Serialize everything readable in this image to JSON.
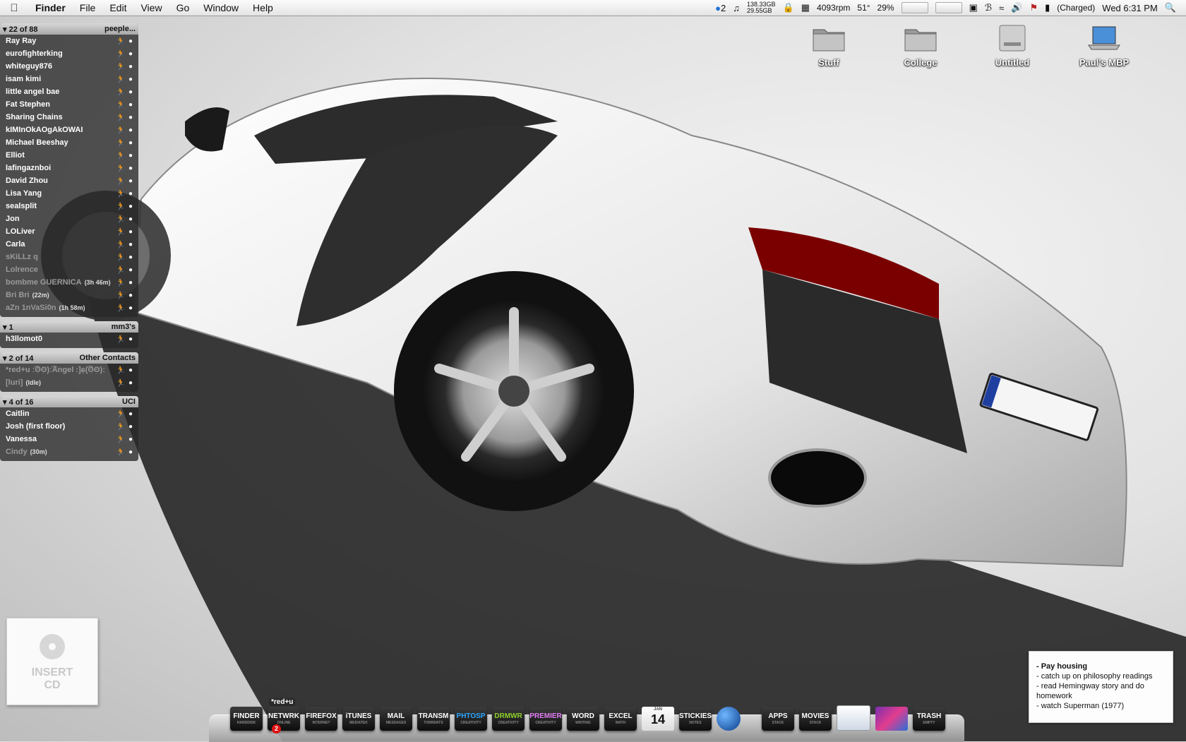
{
  "menubar": {
    "app": "Finder",
    "menus": [
      "File",
      "Edit",
      "View",
      "Go",
      "Window",
      "Help"
    ],
    "status": {
      "notify_count": "2",
      "disk_top": "138.33GB",
      "disk_bottom": "29.55GB",
      "fan": "4093rpm",
      "temp": "51°",
      "cpu": "29%",
      "battery": "(Charged)",
      "clock": "Wed 6:31 PM"
    }
  },
  "desktop_icons": [
    {
      "label": "Stuff"
    },
    {
      "label": "College"
    },
    {
      "label": "Untitled"
    },
    {
      "label": "Paul's MBP"
    }
  ],
  "buddy_list": {
    "groups": [
      {
        "count": "22 of 88",
        "name": "peeple...",
        "buddies": [
          {
            "name": "Ray Ray",
            "note": "",
            "idle": false
          },
          {
            "name": "eurofighterking",
            "note": "",
            "idle": false
          },
          {
            "name": "whiteguy876",
            "note": "",
            "idle": false
          },
          {
            "name": "isam kimi",
            "note": "",
            "idle": false
          },
          {
            "name": "little angel bae",
            "note": "",
            "idle": false
          },
          {
            "name": "Fat Stephen",
            "note": "",
            "idle": false
          },
          {
            "name": "Sharing Chains",
            "note": "",
            "idle": false
          },
          {
            "name": "kIMInOkAOgAkOWAI",
            "note": "",
            "idle": false
          },
          {
            "name": "Michael Beeshay",
            "note": "",
            "idle": false
          },
          {
            "name": "Elliot",
            "note": "",
            "idle": false
          },
          {
            "name": "lafingaznboi",
            "note": "",
            "idle": false
          },
          {
            "name": "David Zhou",
            "note": "",
            "idle": false
          },
          {
            "name": "Lisa Yang",
            "note": "",
            "idle": false
          },
          {
            "name": "sealsplit",
            "note": "",
            "idle": false
          },
          {
            "name": "Jon",
            "note": "",
            "idle": false
          },
          {
            "name": "LOLiver",
            "note": "",
            "idle": false
          },
          {
            "name": "Carla",
            "note": "",
            "idle": false
          },
          {
            "name": "sKiLLz q",
            "note": "",
            "idle": true
          },
          {
            "name": "Lolrence",
            "note": "",
            "idle": true
          },
          {
            "name": "bombme GUERNICA",
            "note": "(3h 46m)",
            "idle": true
          },
          {
            "name": "Bri Bri",
            "note": "(22m)",
            "idle": true
          },
          {
            "name": "aZn 1nVaSi0n",
            "note": "(1h 58m)",
            "idle": true
          }
        ]
      },
      {
        "count": "1",
        "name": "mm3's",
        "buddies": [
          {
            "name": "h3llomot0",
            "note": "",
            "idle": false
          }
        ]
      },
      {
        "count": "2 of 14",
        "name": "Other Contacts",
        "buddies": [
          {
            "name": "*red+u ː͡ʘ͜ʘ)ː͡Angel :]ɕ̜(͡ʘ͜ʘ)ː",
            "note": "",
            "idle": true
          },
          {
            "name": "[luri]",
            "note": "(Idle)",
            "idle": true
          }
        ]
      },
      {
        "count": "4 of 16",
        "name": "UCI",
        "buddies": [
          {
            "name": "Caitlin",
            "note": "",
            "idle": false
          },
          {
            "name": "Josh (first floor)",
            "note": "",
            "idle": false
          },
          {
            "name": "Vanessa",
            "note": "",
            "idle": false
          },
          {
            "name": "Cindy",
            "note": "(30m)",
            "idle": true
          }
        ]
      }
    ]
  },
  "insert_cd": {
    "line1": "INSERT",
    "line2": "CD"
  },
  "sticky": {
    "title": "- Pay housing",
    "items": [
      "- catch up on philosophy readings",
      "- read Hemingway story and do homework",
      "- watch Superman (1977)"
    ]
  },
  "dock": {
    "items_left": [
      {
        "label": "FINDER",
        "sub": "HARDDISK",
        "color": "#ffffff"
      },
      {
        "label": "NETWRK",
        "sub": "ONLINE",
        "color": "#ffffff"
      },
      {
        "label": "FIREFOX",
        "sub": "INTERNET",
        "color": "#ffffff"
      },
      {
        "label": "iTUNES",
        "sub": "MEDIATEK",
        "color": "#ffffff"
      },
      {
        "label": "MAIL",
        "sub": "MESSAGES",
        "color": "#ffffff"
      },
      {
        "label": "TRANSM",
        "sub": "TORRENTS",
        "color": "#ffffff"
      },
      {
        "label": "PHTOSP",
        "sub": "CREATIVITY",
        "color": "#2aa7ff"
      },
      {
        "label": "DRMWR",
        "sub": "CREATIVITY",
        "color": "#8ed12a"
      },
      {
        "label": "PREMIER",
        "sub": "CREATIVITY",
        "color": "#e37df5"
      },
      {
        "label": "WORD",
        "sub": "WRITING",
        "color": "#ffffff"
      },
      {
        "label": "EXCEL",
        "sub": "MATH",
        "color": "#ffffff"
      }
    ],
    "netwrk_top": "*red+u",
    "netwrk_badge": "2",
    "calendar": {
      "month": "JAN",
      "day": "14"
    },
    "stickies": {
      "label": "STICKIES",
      "sub": "NOTES"
    },
    "items_right": [
      {
        "label": "APPS",
        "sub": "STACK"
      },
      {
        "label": "MOVIES",
        "sub": "STACK"
      }
    ],
    "trash": {
      "label": "TRASH",
      "sub": "EMPTY"
    }
  }
}
